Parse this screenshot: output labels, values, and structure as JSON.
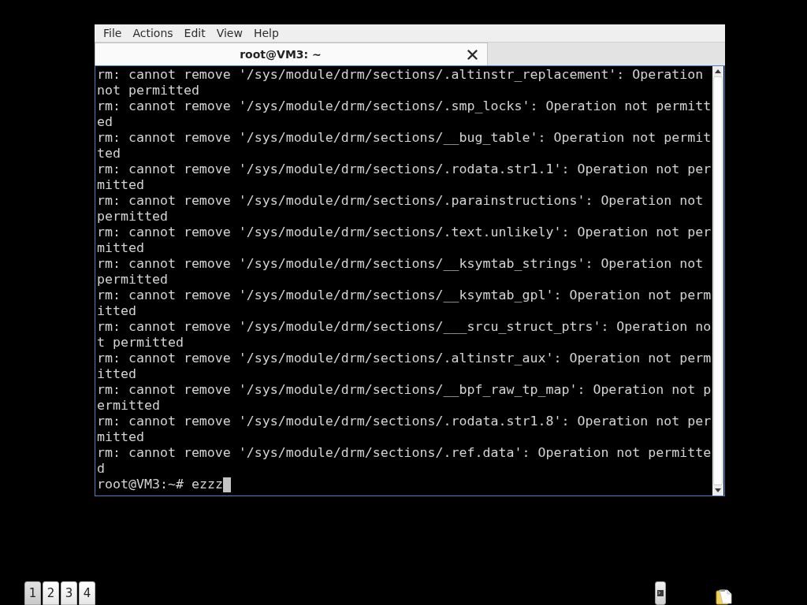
{
  "window": {
    "menu": [
      "File",
      "Actions",
      "Edit",
      "View",
      "Help"
    ],
    "tabs": [
      {
        "title": "root@VM3: ~",
        "selected": true
      }
    ]
  },
  "terminal": {
    "lines": [
      "rm: cannot remove '/sys/module/drm/sections/.altinstr_replacement': Operation not permitted",
      "rm: cannot remove '/sys/module/drm/sections/.smp_locks': Operation not permitted",
      "rm: cannot remove '/sys/module/drm/sections/__bug_table': Operation not permitted",
      "rm: cannot remove '/sys/module/drm/sections/.rodata.str1.1': Operation not permitted",
      "rm: cannot remove '/sys/module/drm/sections/.parainstructions': Operation not permitted",
      "rm: cannot remove '/sys/module/drm/sections/.text.unlikely': Operation not permitted",
      "rm: cannot remove '/sys/module/drm/sections/__ksymtab_strings': Operation not permitted",
      "rm: cannot remove '/sys/module/drm/sections/__ksymtab_gpl': Operation not permitted",
      "rm: cannot remove '/sys/module/drm/sections/___srcu_struct_ptrs': Operation not permitted",
      "rm: cannot remove '/sys/module/drm/sections/.altinstr_aux': Operation not permitted",
      "rm: cannot remove '/sys/module/drm/sections/__bpf_raw_tp_map': Operation not permitted",
      "rm: cannot remove '/sys/module/drm/sections/.rodata.str1.8': Operation not permitted",
      "rm: cannot remove '/sys/module/drm/sections/.ref.data': Operation not permitted"
    ],
    "prompt": "root@VM3:~#",
    "command": "ezzz",
    "cursor": true
  },
  "taskbar": {
    "workspaces": [
      {
        "label": "1",
        "selected": true
      },
      {
        "label": "2",
        "selected": false
      },
      {
        "label": "3",
        "selected": false
      },
      {
        "label": "4",
        "selected": false
      }
    ],
    "tray": [
      {
        "kind": "terminal"
      },
      {
        "kind": "clipboard"
      }
    ]
  }
}
